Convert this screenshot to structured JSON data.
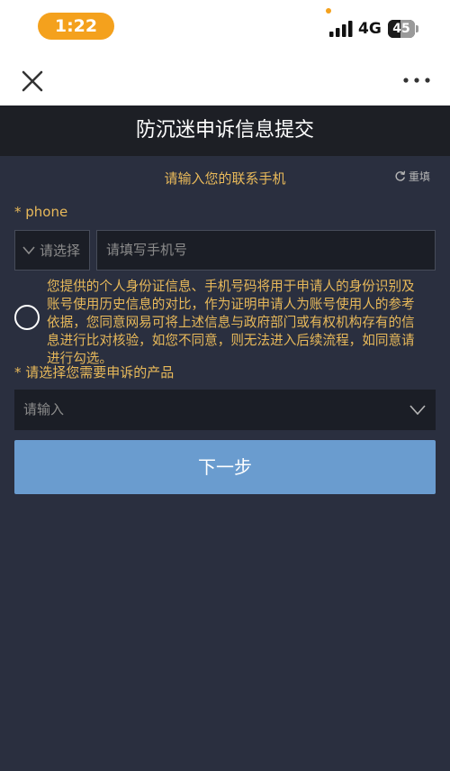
{
  "status_bar": {
    "time": "1:22",
    "network": "4G",
    "battery_level": "45"
  },
  "nav": {
    "close_icon": "close-icon",
    "more_icon": "more-horizontal-icon"
  },
  "header": {
    "title": "防沉迷申诉信息提交"
  },
  "form": {
    "instruction": "请输入您的联系手机",
    "reset_label": "重填",
    "reset_icon": "refresh-icon",
    "phone_label": "* phone",
    "country_select_label": "请选择",
    "phone_placeholder": "请填写手机号",
    "consent_lines": [
      "您提供的个人身份证信息、手机号码将用于申请人的身份识别及",
      "账号使用历史信息的对比，作为证明申请人为账号使用人的参考",
      "依据，您同意网易可将上述信息与政府部门或有权机构存有的信",
      "息进行比对核验，如您不同意，则无法进入后续流程，如同意请",
      "进行勾选。"
    ],
    "product_label": "* 请选择您需要申诉的产品",
    "product_placeholder": "请输入",
    "next_button_label": "下一步"
  },
  "colors": {
    "background": "#2a2f3f",
    "title_bar": "#1d1f25",
    "accent_text": "#e8b95a",
    "primary_button": "#6a9ccf",
    "time_pill": "#f4a11d"
  }
}
